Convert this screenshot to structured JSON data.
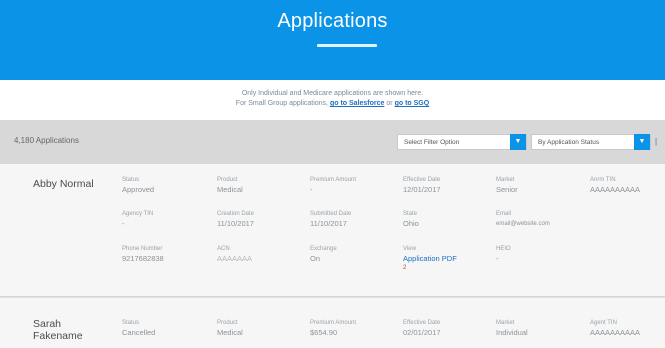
{
  "header": {
    "title": "Applications"
  },
  "notice": {
    "line1": "Only Individual and Medicare applications are shown here.",
    "line2_prefix": "For Small Group applications,",
    "link1": "go to Salesforce",
    "or_text": "or",
    "link2": "go to SGQ"
  },
  "toolbar": {
    "count": "4,180 Applications",
    "filter_select": "Select Filter Option",
    "sort_select": "By Application Status"
  },
  "applications": [
    {
      "name": "Abby Normal",
      "fields": [
        {
          "label": "Status",
          "value": "Approved"
        },
        {
          "label": "Product",
          "value": "Medical"
        },
        {
          "label": "Premium Amount",
          "value": "-"
        },
        {
          "label": "Effective Date",
          "value": "12/01/2017"
        },
        {
          "label": "Market",
          "value": "Senior"
        },
        {
          "label": "Anrm TIN",
          "value": "AAAAAAAAAA"
        },
        {
          "label": "Agency TIN",
          "value": "-"
        },
        {
          "label": "Creation Date",
          "value": "11/10/2017"
        },
        {
          "label": "Submitted Date",
          "value": "11/10/2017"
        },
        {
          "label": "State",
          "value": "Ohio"
        },
        {
          "label": "Email",
          "value": "email@website.com"
        },
        {
          "label": "Phone Number",
          "value": "9217682838"
        },
        {
          "label": "ACN",
          "value": "AAAAAAA"
        },
        {
          "label": "Exchange",
          "value": "On"
        },
        {
          "label": "View",
          "value": "Application PDF"
        },
        {
          "label": "HEIO",
          "value": "-"
        }
      ],
      "pdf_badge": "2"
    },
    {
      "name": "Sarah Fakename",
      "fields": [
        {
          "label": "Status",
          "value": "Cancelled"
        },
        {
          "label": "Product",
          "value": "Medical"
        },
        {
          "label": "Premium Amount",
          "value": "$654.90"
        },
        {
          "label": "Effective Date",
          "value": "02/01/2017"
        },
        {
          "label": "Market",
          "value": "Individual"
        },
        {
          "label": "Agent TIN",
          "value": "AAAAAAAAAA"
        }
      ]
    }
  ]
}
